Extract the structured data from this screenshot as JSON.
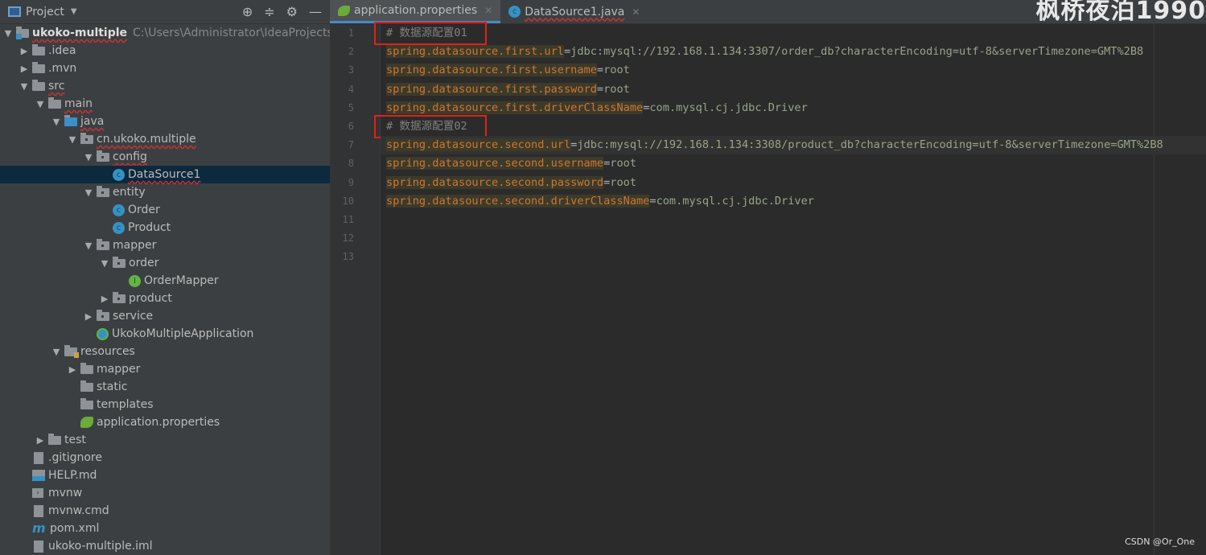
{
  "sidebar": {
    "title": "Project",
    "tree": [
      {
        "depth": 0,
        "arrow": "down",
        "icon": "module",
        "label": "ukoko-multiple",
        "bold": true,
        "wavy": true,
        "path": "C:\\Users\\Administrator\\IdeaProjects\\ukoko-multiple"
      },
      {
        "depth": 1,
        "arrow": "right",
        "icon": "folder",
        "label": ".idea"
      },
      {
        "depth": 1,
        "arrow": "right",
        "icon": "folder",
        "label": ".mvn"
      },
      {
        "depth": 1,
        "arrow": "down",
        "icon": "folder",
        "label": "src",
        "wavy": true
      },
      {
        "depth": 2,
        "arrow": "down",
        "icon": "folder",
        "label": "main",
        "wavy": true
      },
      {
        "depth": 3,
        "arrow": "down",
        "icon": "folder-blue",
        "label": "java",
        "wavy": true
      },
      {
        "depth": 4,
        "arrow": "down",
        "icon": "package",
        "label": "cn.ukoko.multiple",
        "wavy": true
      },
      {
        "depth": 5,
        "arrow": "down",
        "icon": "package",
        "label": "config",
        "wavy": true
      },
      {
        "depth": 6,
        "arrow": "none",
        "icon": "class",
        "label": "DataSource1",
        "wavy": true,
        "selected": true
      },
      {
        "depth": 5,
        "arrow": "down",
        "icon": "package",
        "label": "entity"
      },
      {
        "depth": 6,
        "arrow": "none",
        "icon": "class",
        "label": "Order"
      },
      {
        "depth": 6,
        "arrow": "none",
        "icon": "class",
        "label": "Product"
      },
      {
        "depth": 5,
        "arrow": "down",
        "icon": "package",
        "label": "mapper"
      },
      {
        "depth": 6,
        "arrow": "down",
        "icon": "package",
        "label": "order"
      },
      {
        "depth": 7,
        "arrow": "none",
        "icon": "interface",
        "label": "OrderMapper"
      },
      {
        "depth": 6,
        "arrow": "right",
        "icon": "package",
        "label": "product"
      },
      {
        "depth": 5,
        "arrow": "right",
        "icon": "package",
        "label": "service"
      },
      {
        "depth": 5,
        "arrow": "none",
        "icon": "spring-app",
        "label": "UkokoMultipleApplication"
      },
      {
        "depth": 3,
        "arrow": "down",
        "icon": "resources",
        "label": "resources"
      },
      {
        "depth": 4,
        "arrow": "right",
        "icon": "folder",
        "label": "mapper"
      },
      {
        "depth": 4,
        "arrow": "none",
        "icon": "folder",
        "label": "static"
      },
      {
        "depth": 4,
        "arrow": "none",
        "icon": "folder",
        "label": "templates"
      },
      {
        "depth": 4,
        "arrow": "none",
        "icon": "spring-properties",
        "label": "application.properties"
      },
      {
        "depth": 2,
        "arrow": "right",
        "icon": "folder",
        "label": "test"
      },
      {
        "depth": 1,
        "arrow": "none",
        "icon": "file",
        "label": ".gitignore"
      },
      {
        "depth": 1,
        "arrow": "none",
        "icon": "markdown",
        "label": "HELP.md"
      },
      {
        "depth": 1,
        "arrow": "none",
        "icon": "terminal",
        "label": "mvnw"
      },
      {
        "depth": 1,
        "arrow": "none",
        "icon": "file",
        "label": "mvnw.cmd"
      },
      {
        "depth": 1,
        "arrow": "none",
        "icon": "maven",
        "label": "pom.xml"
      },
      {
        "depth": 1,
        "arrow": "none",
        "icon": "file",
        "label": "ukoko-multiple.iml"
      }
    ]
  },
  "tabs": [
    {
      "label": "application.properties",
      "icon": "spring-properties",
      "active": true
    },
    {
      "label": "DataSource1.java",
      "icon": "class",
      "active": false
    }
  ],
  "editor": {
    "current_line": 7,
    "lines": [
      {
        "n": "1",
        "comment": "# 数据源配置01"
      },
      {
        "n": "2",
        "key": "spring.datasource.first.url",
        "value": "jdbc:mysql://192.168.1.134:3307/order_db?characterEncoding=utf-8&serverTimezone=GMT%2B8"
      },
      {
        "n": "3",
        "key": "spring.datasource.first.username",
        "value": "root"
      },
      {
        "n": "4",
        "key": "spring.datasource.first.password",
        "value": "root"
      },
      {
        "n": "5",
        "key": "spring.datasource.first.driverClassName",
        "value": "com.mysql.cj.jdbc.Driver"
      },
      {
        "n": "6",
        "comment": "# 数据源配置02"
      },
      {
        "n": "7",
        "key": "spring.datasource.second.url",
        "value": "jdbc:mysql://192.168.1.134:3308/product_db?characterEncoding=utf-8&serverTimezone=GMT%2B8"
      },
      {
        "n": "8",
        "key": "spring.datasource.second.username",
        "value": "root"
      },
      {
        "n": "9",
        "key": "spring.datasource.second.password",
        "value": "root"
      },
      {
        "n": "10",
        "key": "spring.datasource.second.driverClassName",
        "value": "com.mysql.cj.jdbc.Driver"
      },
      {
        "n": "11"
      },
      {
        "n": "12"
      },
      {
        "n": "13"
      }
    ]
  },
  "watermark": "枫桥夜泊1990",
  "credit": "CSDN @Or_One",
  "colors": {
    "key": "#cc7832",
    "value": "#98a48a",
    "comment": "#808080",
    "highlight_box": "#e2201a",
    "selection": "#0d293e"
  }
}
